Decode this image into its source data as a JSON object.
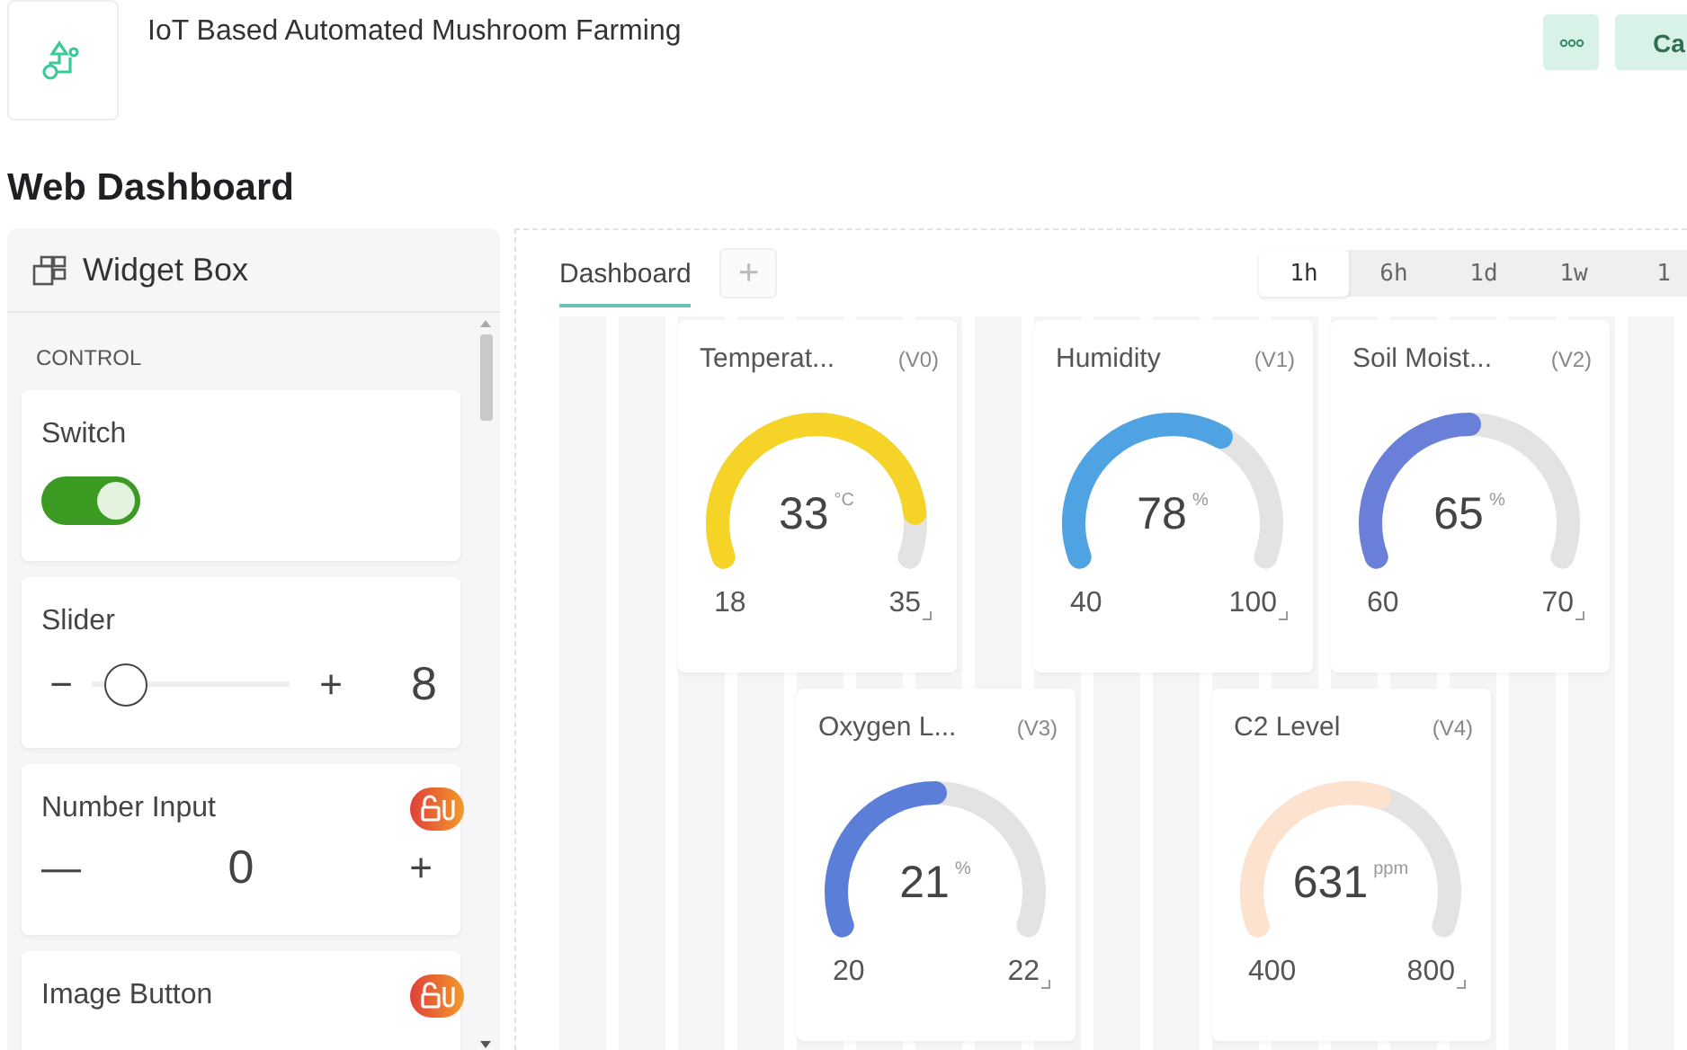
{
  "header": {
    "title": "IoT Based Automated Mushroom Farming",
    "buttons": [
      {
        "kind": "more"
      },
      {
        "kind": "text",
        "label": "Ca"
      }
    ]
  },
  "page_title": "Web Dashboard",
  "widget_box": {
    "title": "Widget Box",
    "section": "CONTROL",
    "widgets": [
      {
        "kind": "switch",
        "label": "Switch",
        "on": true
      },
      {
        "kind": "slider",
        "label": "Slider",
        "minus": "−",
        "plus": "+",
        "value": "8",
        "level": 0.08
      },
      {
        "kind": "number",
        "label": "Number Input",
        "minus": "—",
        "value": "0",
        "plus": "+",
        "locked": true
      },
      {
        "kind": "image_button",
        "label": "Image Button",
        "locked": true
      }
    ]
  },
  "tabs": [
    {
      "label": "Dashboard",
      "selected": true
    }
  ],
  "add_tab": "+",
  "time_ranges": [
    {
      "label": "1h",
      "selected": true
    },
    {
      "label": "6h",
      "selected": false
    },
    {
      "label": "1d",
      "selected": false
    },
    {
      "label": "1w",
      "selected": false
    },
    {
      "label": "1",
      "selected": false
    }
  ],
  "gauges": [
    {
      "title": "Temperat...",
      "pin": "(V0)",
      "value": "33",
      "unit": "°C",
      "min": "18",
      "max": "35",
      "color": "#f5d327"
    },
    {
      "title": "Humidity",
      "pin": "(V1)",
      "value": "78",
      "unit": "%",
      "min": "40",
      "max": "100",
      "color": "#4fa3e3"
    },
    {
      "title": "Soil Moist...",
      "pin": "(V2)",
      "value": "65",
      "unit": "%",
      "min": "60",
      "max": "70",
      "color": "#6a80d8"
    },
    {
      "title": "Oxygen L...",
      "pin": "(V3)",
      "value": "21",
      "unit": "%",
      "min": "20",
      "max": "22",
      "color": "#5b7fd9"
    },
    {
      "title": "C2 Level",
      "pin": "(V4)",
      "value": "631",
      "unit": "ppm",
      "min": "400",
      "max": "800",
      "color": "#fde3cf"
    }
  ]
}
